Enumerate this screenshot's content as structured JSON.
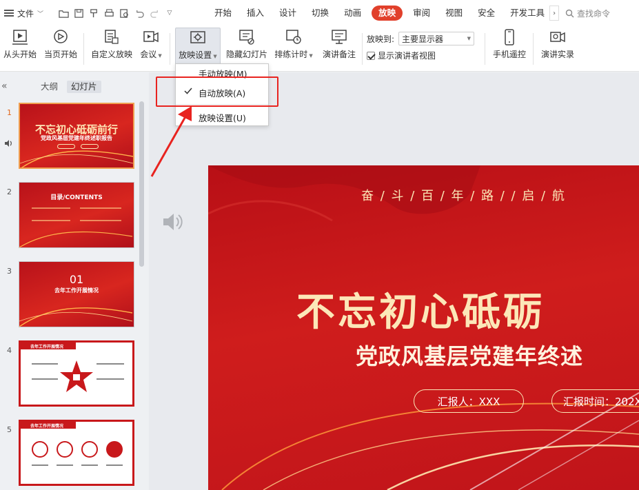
{
  "menubar": {
    "file_label": "文件",
    "tabs": [
      {
        "label": "开始"
      },
      {
        "label": "插入"
      },
      {
        "label": "设计"
      },
      {
        "label": "切换"
      },
      {
        "label": "动画"
      },
      {
        "label": "放映"
      },
      {
        "label": "审阅"
      },
      {
        "label": "视图"
      },
      {
        "label": "安全"
      },
      {
        "label": "开发工具"
      }
    ],
    "active_tab": "放映",
    "search_placeholder": "查找命令"
  },
  "ribbon": {
    "from_start": "从头开始",
    "from_current": "当页开始",
    "custom_show": "自定义放映",
    "meeting": "会议",
    "show_settings": "放映设置",
    "hide_slide": "隐藏幻灯片",
    "rehearse": "排练计时",
    "speaker_notes": "演讲备注",
    "project_to_label": "放映到:",
    "project_to_value": "主要显示器",
    "presenter_view_label": "显示演讲者视图",
    "phone_remote": "手机遥控",
    "record": "演讲实录"
  },
  "dropdown": {
    "items": [
      {
        "label": "手动放映(M)",
        "checked": false
      },
      {
        "label": "自动放映(A)",
        "checked": true
      },
      {
        "label": "放映设置(U)",
        "checked": false
      }
    ]
  },
  "leftpanel": {
    "outline_tab": "大纲",
    "slides_tab": "幻灯片",
    "thumbnails": [
      {
        "number": "1",
        "title": "不忘初心砥砺前行",
        "subtitle": "党政风基层党建年终述职报告"
      },
      {
        "number": "2",
        "title": "目录/CONTENTS",
        "subtitle": ""
      },
      {
        "number": "3",
        "title": "01",
        "subtitle": "去年工作开展情况"
      },
      {
        "number": "4",
        "title": "去年工作开展情况",
        "subtitle": ""
      },
      {
        "number": "5",
        "title": "去年工作开展情况",
        "subtitle": ""
      }
    ]
  },
  "slide": {
    "slogan": "奋 / 斗 / 百 / 年 / 路 / / 启 / 航",
    "title": "不忘初心砥砺",
    "subtitle": "党政风基层党建年终述",
    "reporter": "汇报人：XXX",
    "report_time": "汇报时间：202X"
  },
  "colors": {
    "accent": "#e1402b",
    "slide_red": "#c8181b",
    "gold": "#fce7b8",
    "highlight": "#e8231f"
  }
}
